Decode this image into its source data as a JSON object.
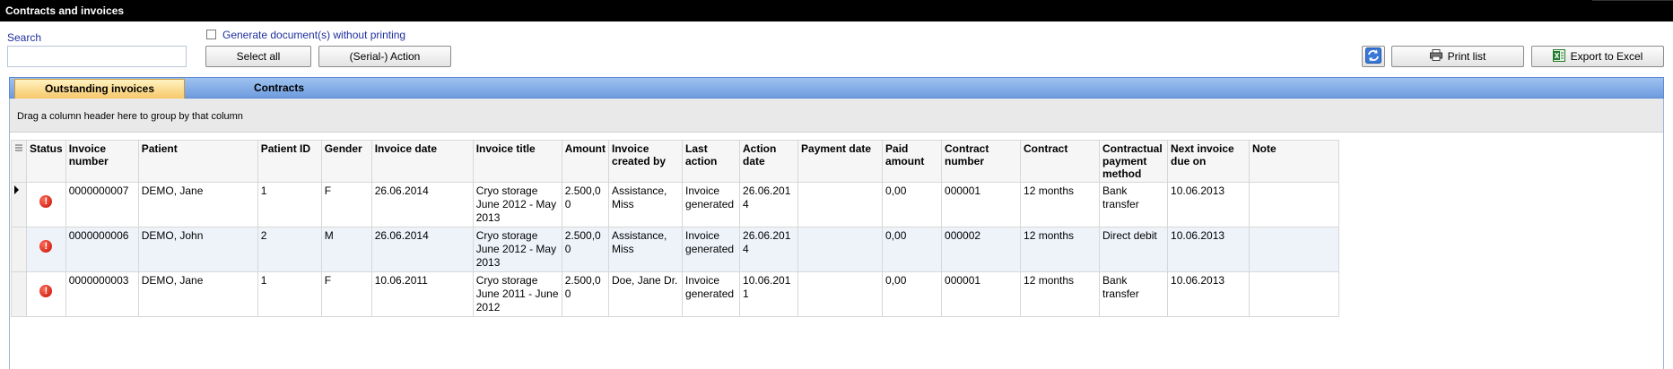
{
  "window": {
    "title": "Contracts and invoices"
  },
  "search": {
    "label": "Search",
    "value": ""
  },
  "options": {
    "generate_without_printing": "Generate document(s) without printing"
  },
  "toolbar": {
    "select_all": "Select all",
    "serial_action": "(Serial-) Action",
    "print_list": "Print list",
    "export_excel": "Export to Excel"
  },
  "tabs": [
    {
      "label": "Outstanding invoices",
      "active": true
    },
    {
      "label": "Contracts",
      "active": false
    }
  ],
  "grid": {
    "group_hint": "Drag a column header here to group by that column",
    "columns": [
      "Status",
      "Invoice number",
      "Patient",
      "Patient ID",
      "Gender",
      "Invoice date",
      "Invoice title",
      "Amount",
      "Invoice created by",
      "Last action",
      "Action date",
      "Payment date",
      "Paid amount",
      "Contract number",
      "Contract",
      "Contractual payment method",
      "Next invoice due on",
      "Note"
    ],
    "rows": [
      [
        "0000000007",
        "DEMO, Jane",
        "1",
        "F",
        "26.06.2014",
        "Cryo storage June 2012 - May 2013",
        "2.500,00",
        "Assistance, Miss",
        "Invoice generated",
        "26.06.2014",
        "",
        "0,00",
        "000001",
        "12 months",
        "Bank transfer",
        "10.06.2013",
        ""
      ],
      [
        "0000000006",
        "DEMO, John",
        "2",
        "M",
        "26.06.2014",
        "Cryo storage June 2012 - May 2013",
        "2.500,00",
        "Assistance, Miss",
        "Invoice generated",
        "26.06.2014",
        "",
        "0,00",
        "000002",
        "12 months",
        "Direct debit",
        "10.06.2013",
        ""
      ],
      [
        "0000000003",
        "DEMO, Jane",
        "1",
        "F",
        "10.06.2011",
        "Cryo storage June 2011 - June 2012",
        "2.500,00",
        "Doe, Jane Dr.",
        "Invoice generated",
        "10.06.2011",
        "",
        "0,00",
        "000001",
        "12 months",
        "Bank transfer",
        "10.06.2013",
        ""
      ]
    ]
  },
  "colors": {
    "tab_active": "#f7c86a",
    "tabstrip": "#7fa8e6",
    "status_error": "#d01a0a",
    "link_text": "#1d2f9c"
  }
}
